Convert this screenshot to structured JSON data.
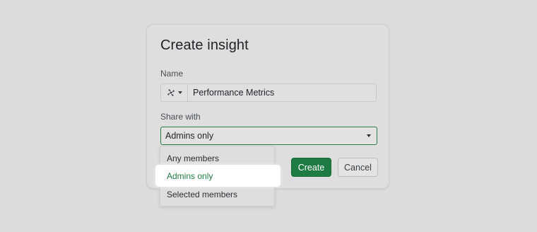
{
  "dialog": {
    "title": "Create insight",
    "name_label": "Name",
    "name_value": "Performance Metrics",
    "share_label": "Share with",
    "share_value": "Admins only",
    "create_label": "Create",
    "cancel_label": "Cancel"
  },
  "dropdown": {
    "options": [
      "Any members",
      "Admins only",
      "Selected members"
    ],
    "selected": "Admins only"
  },
  "colors": {
    "accent": "#1d7b43",
    "focus_border": "#2c7a4b",
    "background": "#dcdcdc"
  },
  "icons": {
    "insight_icon": "pinwheel-icon",
    "picker_caret": "caret-down-icon",
    "select_caret": "caret-down-icon"
  }
}
